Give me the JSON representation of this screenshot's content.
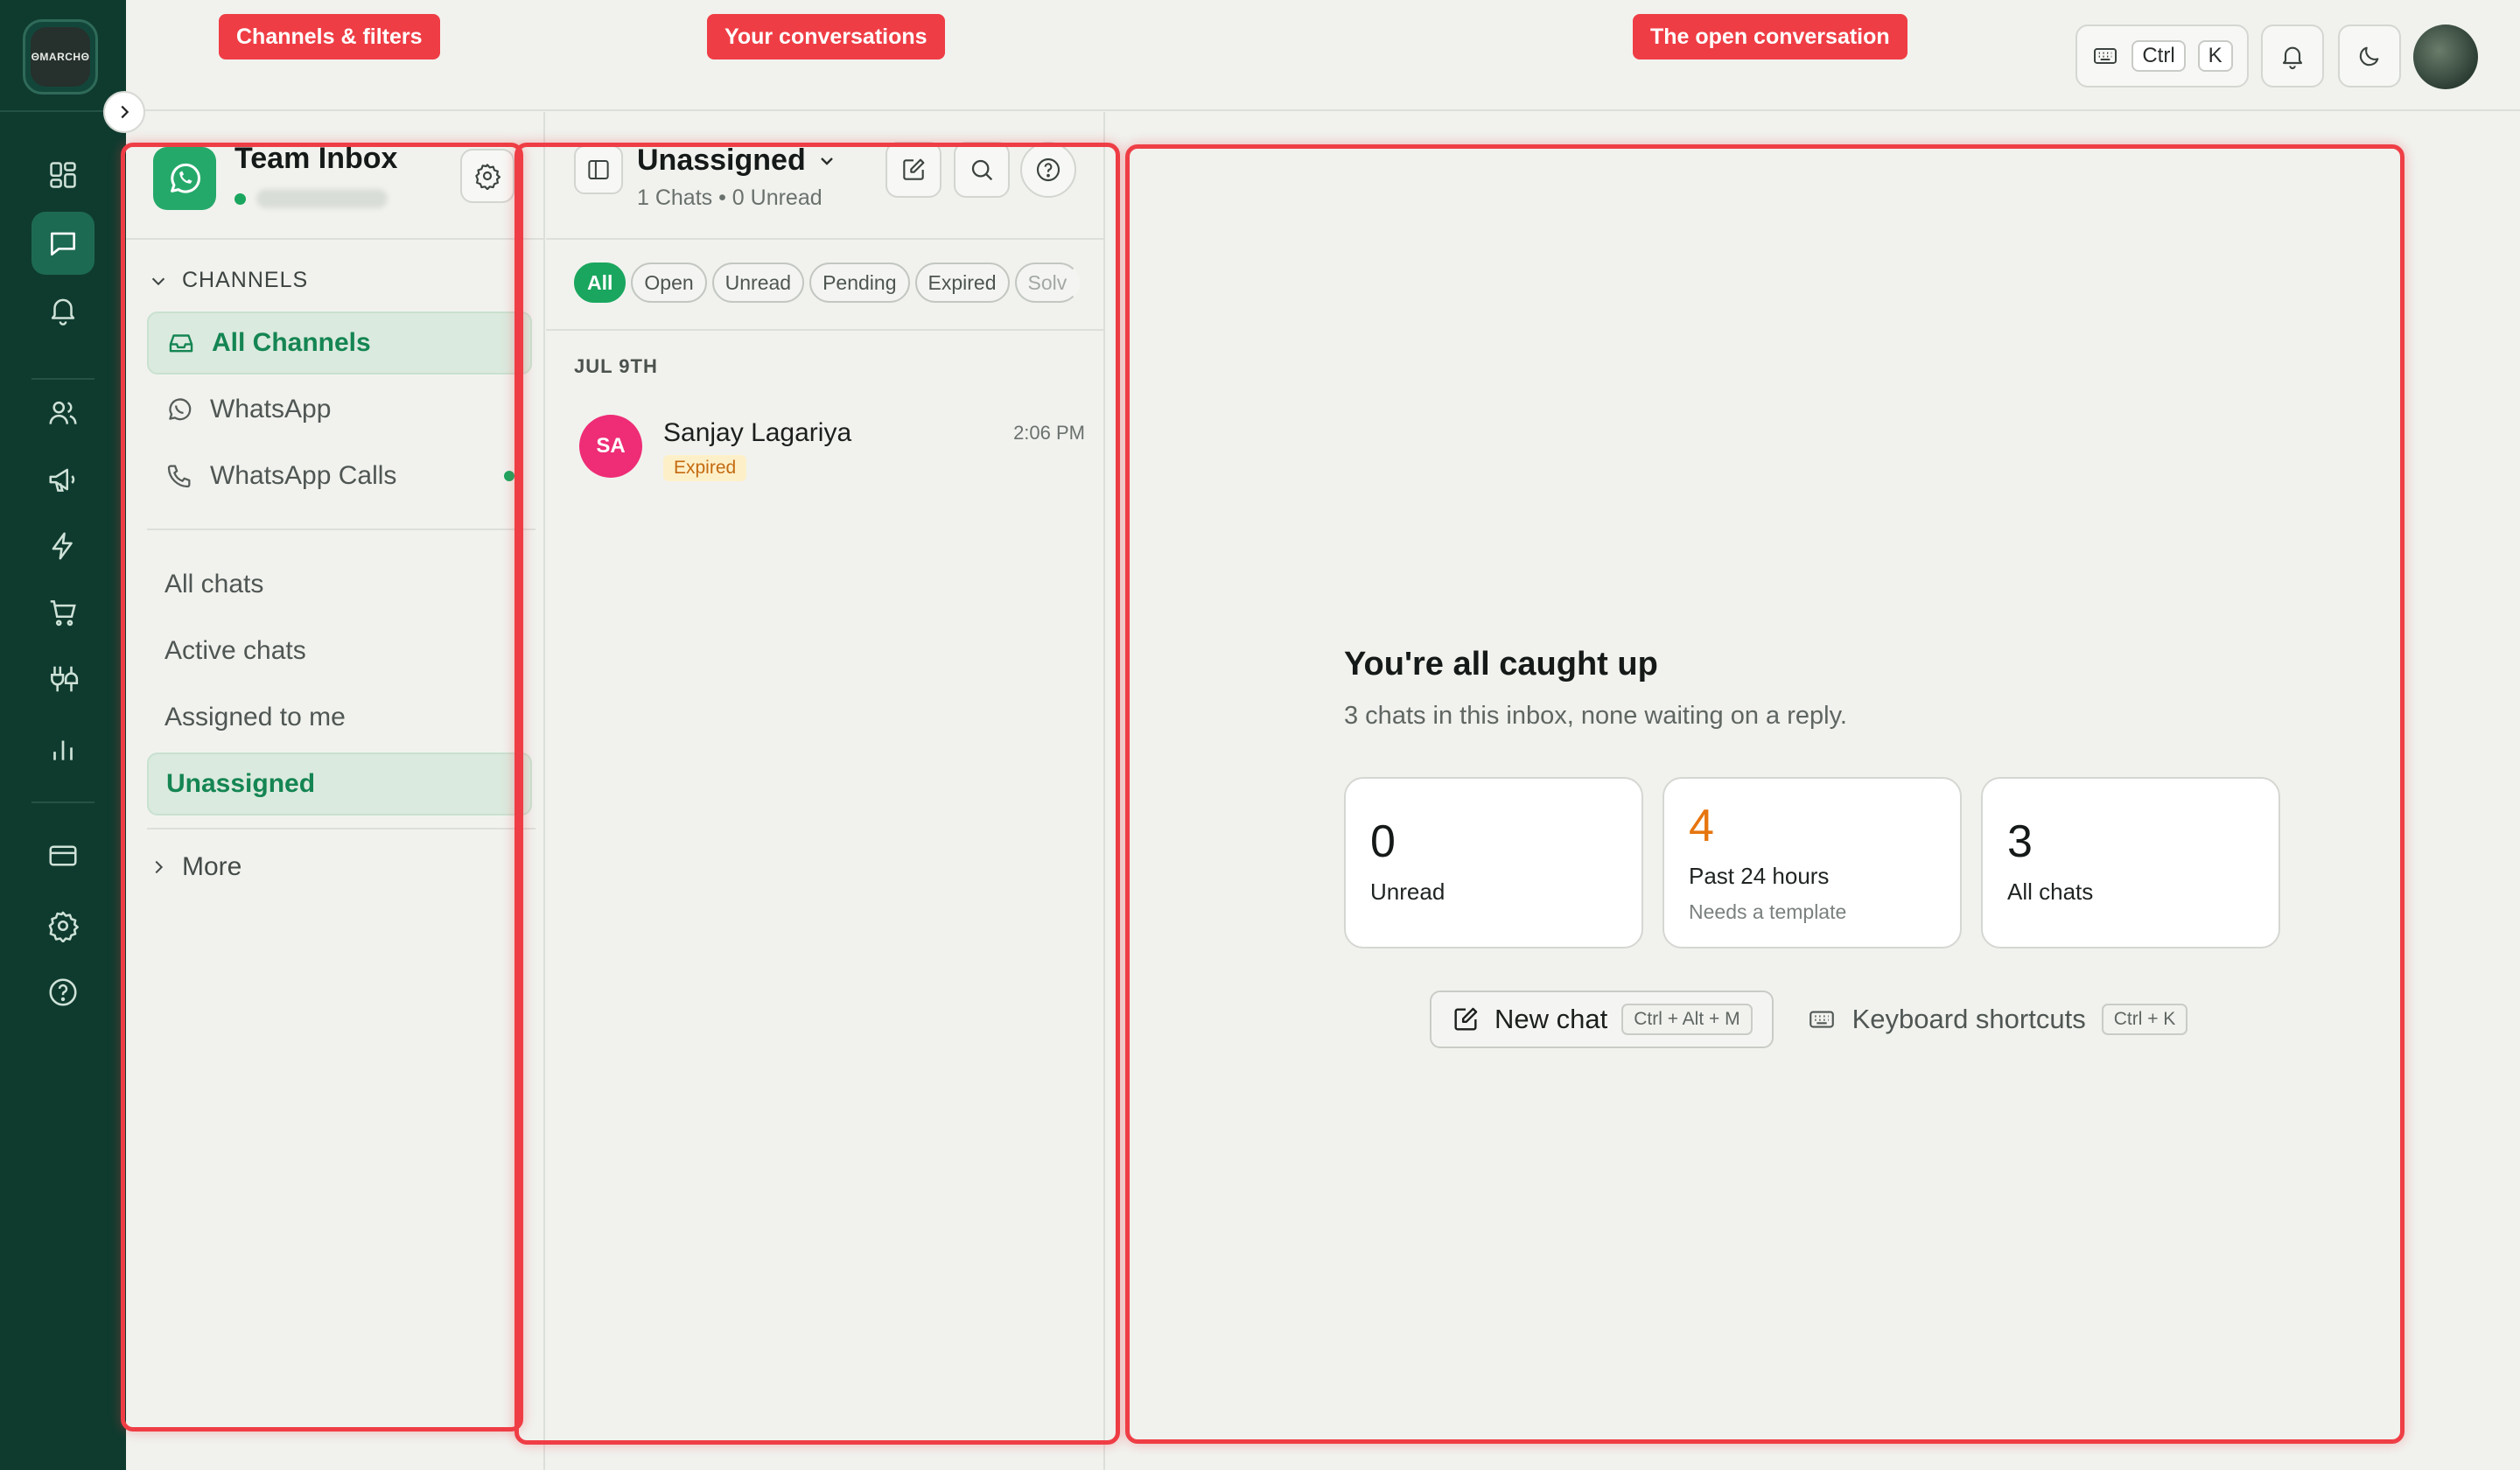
{
  "rail": {
    "logo_text": "ΘMARCHΘ",
    "icons": [
      "dashboard-icon",
      "chat-icon",
      "bell-icon",
      "users-icon",
      "megaphone-icon",
      "lightning-icon",
      "cart-icon",
      "integrations-icon",
      "analytics-icon",
      "billing-icon",
      "settings-icon",
      "help-icon"
    ],
    "active": "chat-icon",
    "colors": {
      "bg": "#0f3b2f",
      "active": "#1d6a52",
      "icon": "#cfe2d8"
    }
  },
  "topbar": {
    "shortcut_keys": [
      "Ctrl",
      "K"
    ],
    "icons": [
      "keyboard-icon",
      "bell-icon",
      "moon-icon"
    ]
  },
  "annotations": {
    "channels": "Channels & filters",
    "conversations": "Your conversations",
    "open_conversation": "The open conversation"
  },
  "inbox": {
    "title": "Team Inbox",
    "status": "online",
    "channels_header": "CHANNELS",
    "channels": [
      {
        "label": "All Channels",
        "icon": "inbox-icon",
        "active": true
      },
      {
        "label": "WhatsApp",
        "icon": "whatsapp-icon",
        "active": false
      },
      {
        "label": "WhatsApp Calls",
        "icon": "phone-icon",
        "active": false,
        "live": true
      }
    ],
    "views": [
      {
        "label": "All chats",
        "active": false
      },
      {
        "label": "Active chats",
        "active": false
      },
      {
        "label": "Assigned to me",
        "active": false
      },
      {
        "label": "Unassigned",
        "active": true
      }
    ],
    "more_label": "More"
  },
  "conversations": {
    "title": "Unassigned",
    "subtitle": "1 Chats • 0 Unread",
    "filters": [
      "All",
      "Open",
      "Unread",
      "Pending",
      "Expired",
      "Solv"
    ],
    "active_filter": "All",
    "date_group": "JUL 9TH",
    "items": [
      {
        "initials": "SA",
        "name": "Sanjay Lagariya",
        "time": "2:06 PM",
        "badge": "Expired"
      }
    ]
  },
  "empty_state": {
    "title": "You're all caught up",
    "subtitle": "3 chats in this inbox, none waiting on a reply.",
    "stats": [
      {
        "value": "0",
        "label": "Unread",
        "hint": ""
      },
      {
        "value": "4",
        "label": "Past 24 hours",
        "hint": "Needs a template"
      },
      {
        "value": "3",
        "label": "All chats",
        "hint": ""
      }
    ],
    "new_chat_label": "New chat",
    "new_chat_shortcut": "Ctrl + Alt + M",
    "shortcuts_label": "Keyboard shortcuts",
    "shortcuts_shortcut": "Ctrl + K"
  },
  "colors": {
    "accent": "#1aa65e",
    "annotation": "#ef3d45",
    "warning": "#e6750f",
    "avatar": "#ee2d76"
  }
}
